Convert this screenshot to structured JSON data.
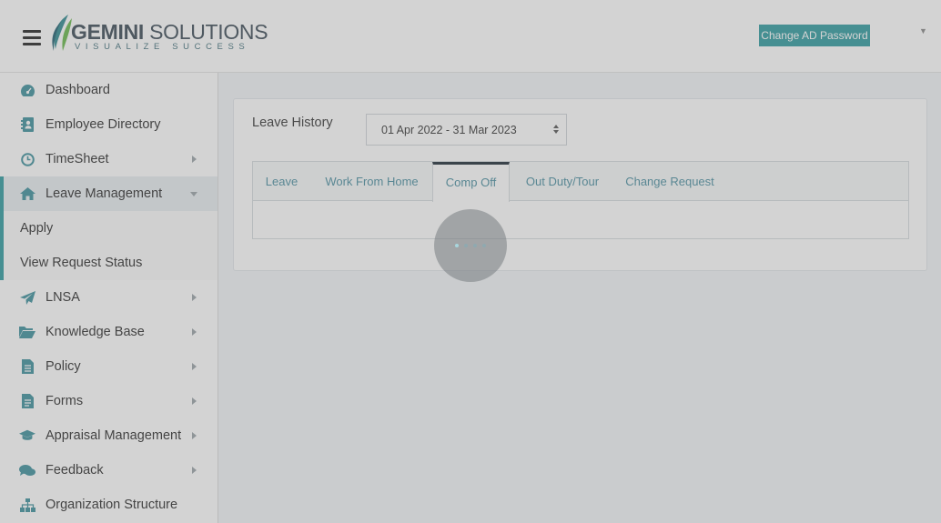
{
  "header": {
    "logo": {
      "brand_main": "GEMINI",
      "brand_rest": " SOLUTIONS",
      "tagline": "VISUALIZE SUCCESS"
    },
    "change_password_label": "Change AD Password"
  },
  "sidebar": {
    "items": [
      {
        "label": "Dashboard",
        "icon": "dashboard-icon",
        "submenu": false
      },
      {
        "label": "Employee Directory",
        "icon": "address-book-icon",
        "submenu": false
      },
      {
        "label": "TimeSheet",
        "icon": "clock-icon",
        "submenu": true
      },
      {
        "label": "Leave Management",
        "icon": "home-icon",
        "submenu": true,
        "expanded": true
      },
      {
        "label": "LNSA",
        "icon": "paper-plane-icon",
        "submenu": true
      },
      {
        "label": "Knowledge Base",
        "icon": "folder-open-icon",
        "submenu": true
      },
      {
        "label": "Policy",
        "icon": "document-icon",
        "submenu": true
      },
      {
        "label": "Forms",
        "icon": "file-icon",
        "submenu": true
      },
      {
        "label": "Appraisal Management",
        "icon": "graduation-cap-icon",
        "submenu": true
      },
      {
        "label": "Feedback",
        "icon": "comments-icon",
        "submenu": true
      },
      {
        "label": "Organization Structure",
        "icon": "sitemap-icon",
        "submenu": false
      }
    ],
    "leave_submenu": [
      "Apply",
      "View Request Status"
    ]
  },
  "main": {
    "leave_history_label": "Leave History",
    "period_select": {
      "value": "01 Apr 2022 - 31 Mar 2023"
    },
    "tabs": [
      {
        "label": "Leave",
        "active": false
      },
      {
        "label": "Work From Home",
        "active": false
      },
      {
        "label": "Comp Off",
        "active": true
      },
      {
        "label": "Out Duty/Tour",
        "active": false
      },
      {
        "label": "Change Request",
        "active": false
      }
    ]
  },
  "colors": {
    "accent": "#2e9a9e",
    "tab_text": "#4a8ea0",
    "active_tab_border": "#1d2b35"
  }
}
